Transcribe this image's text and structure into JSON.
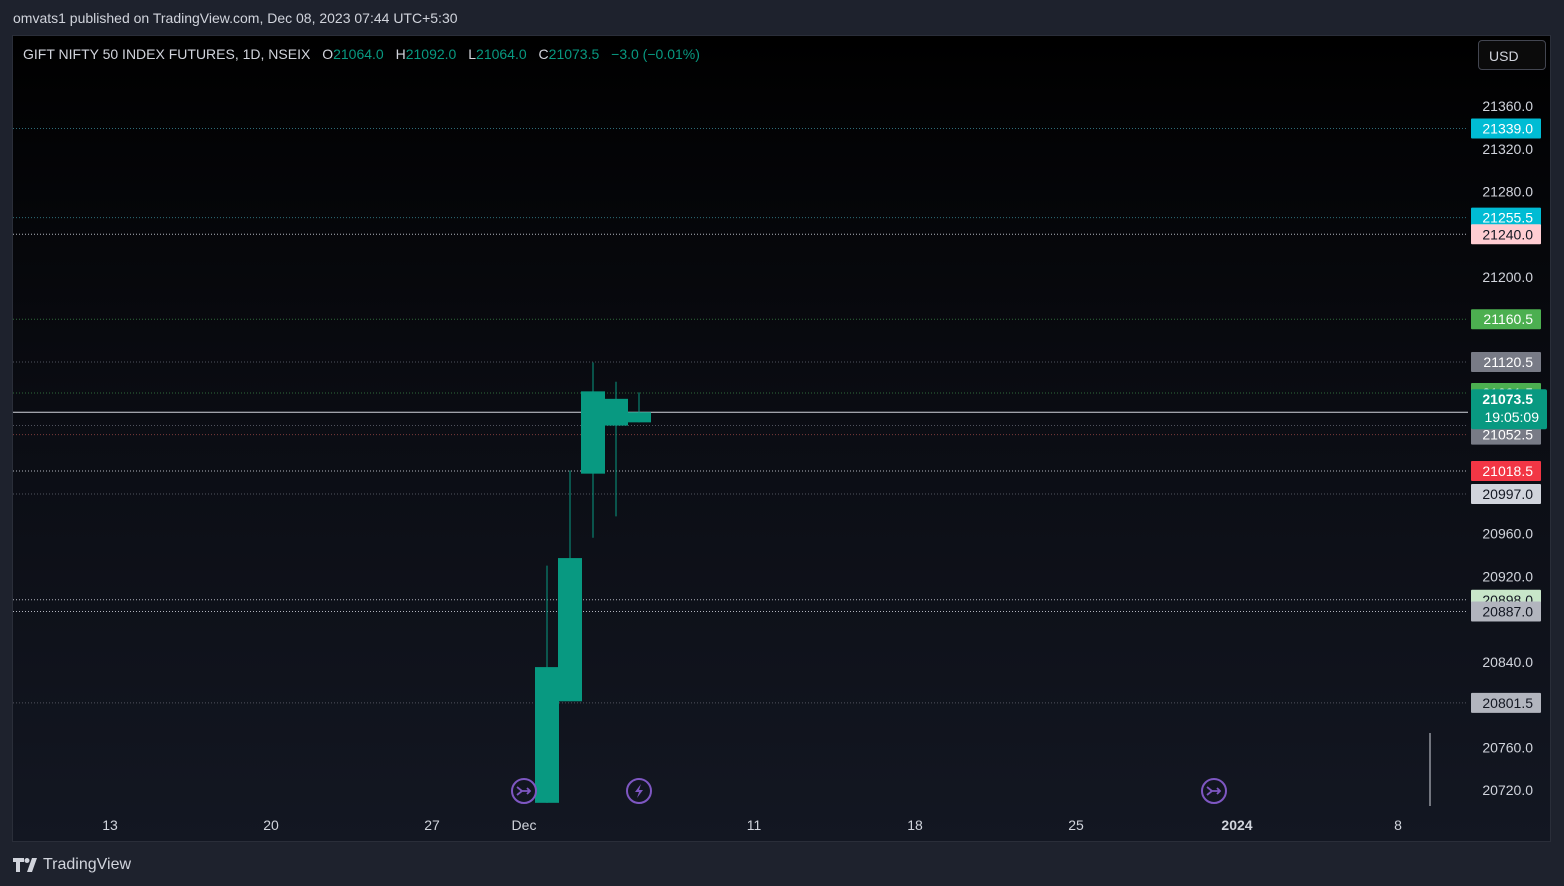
{
  "header": {
    "published": "omvats1 published on TradingView.com, Dec 08, 2023 07:44 UTC+5:30"
  },
  "legend": {
    "symbol": "GIFT NIFTY 50 INDEX FUTURES, 1D, NSEIX",
    "o_label": "O",
    "o_value": "21064.0",
    "h_label": "H",
    "h_value": "21092.0",
    "l_label": "L",
    "l_value": "21064.0",
    "c_label": "C",
    "c_value": "21073.5",
    "change": "−3.0 (−0.01%)"
  },
  "currency": "USD",
  "footer": {
    "brand": "TradingView"
  },
  "colors": {
    "up": "#089981",
    "down": "#f23645",
    "text": "#d1d4dc",
    "cyan": "#00bcd4",
    "green": "#4caf50",
    "pink": "#ffcdd2",
    "lightblue": "#bbdefb",
    "grey": "#787b86",
    "lightgrey": "#b2b5be",
    "lightgreen": "#c8e6c9",
    "white": "#ffffff"
  },
  "chart_data": {
    "type": "candlestick",
    "ylim": [
      20708,
      21381
    ],
    "y_ticks": [
      "20720.0",
      "20760.0",
      "20840.0",
      "20920.0",
      "20960.0",
      "21200.0",
      "21280.0",
      "21320.0",
      "21360.0"
    ],
    "x_ticks": [
      {
        "label": "13",
        "day": -14
      },
      {
        "label": "20",
        "day": -7
      },
      {
        "label": "27",
        "day": 0
      },
      {
        "label": "Dec",
        "day": 4
      },
      {
        "label": "11",
        "day": 14
      },
      {
        "label": "18",
        "day": 21
      },
      {
        "label": "25",
        "day": 28
      },
      {
        "label": "2024",
        "day": 35
      },
      {
        "label": "8",
        "day": 42
      }
    ],
    "candles": [
      {
        "day": 5,
        "open": 20708,
        "high": 20930,
        "low": 20708,
        "close": 20835
      },
      {
        "day": 6,
        "open": 20803,
        "high": 21019,
        "low": 20803,
        "close": 20937
      },
      {
        "day": 7,
        "open": 21016,
        "high": 21120,
        "low": 20956,
        "close": 21093
      },
      {
        "day": 8,
        "open": 21061,
        "high": 21102,
        "low": 20976,
        "close": 21086
      },
      {
        "day": 9,
        "open": 21064,
        "high": 21092,
        "low": 21064,
        "close": 21073.5
      }
    ],
    "levels": [
      {
        "value": "21339.0",
        "color": "#00bcd4",
        "text_color": "#ffffff",
        "line": "#2e6d78"
      },
      {
        "value": "21255.5",
        "color": "#00bcd4",
        "text_color": "#ffffff",
        "line": "#2e6d78"
      },
      {
        "value": "21240.0",
        "color": "#ffcdd2",
        "text_color": "#131722",
        "line": "#b2b5be"
      },
      {
        "value": "21160.5",
        "color": "#4caf50",
        "text_color": "#ffffff",
        "line": "#2f6b3a"
      },
      {
        "value": "21120.5",
        "color": "#787b86",
        "text_color": "#ffffff",
        "line": "#50535e"
      },
      {
        "value": "21091.5",
        "color": "#4caf50",
        "text_color": "#ffffff",
        "line": "#2f6b3a"
      },
      {
        "value": "21061.0",
        "color": "#bbdefb",
        "text_color": "#131722",
        "line": "#50535e"
      },
      {
        "value": "21052.5",
        "color": "#787b86",
        "text_color": "#ffffff",
        "line": "#7a3a3a"
      },
      {
        "value": "21018.5",
        "color": "#f23645",
        "text_color": "#ffffff",
        "line": "#b2b5be"
      },
      {
        "value": "20997.0",
        "color": "#d1d4dc",
        "text_color": "#131722",
        "line": "#50535e"
      },
      {
        "value": "20898.0",
        "color": "#c8e6c9",
        "text_color": "#131722",
        "line": "#b2b5be"
      },
      {
        "value": "20887.0",
        "color": "#b2b5be",
        "text_color": "#131722",
        "line": "#b2b5be"
      },
      {
        "value": "20801.5",
        "color": "#b2b5be",
        "text_color": "#131722",
        "line": "#50535e"
      }
    ],
    "last_price": {
      "value": "21073.5",
      "countdown": "19:05:09"
    },
    "event_icons": [
      {
        "day": 4,
        "kind": "split-icon"
      },
      {
        "day": 9,
        "kind": "lightning-icon"
      },
      {
        "day": 34,
        "kind": "split-icon"
      }
    ]
  }
}
